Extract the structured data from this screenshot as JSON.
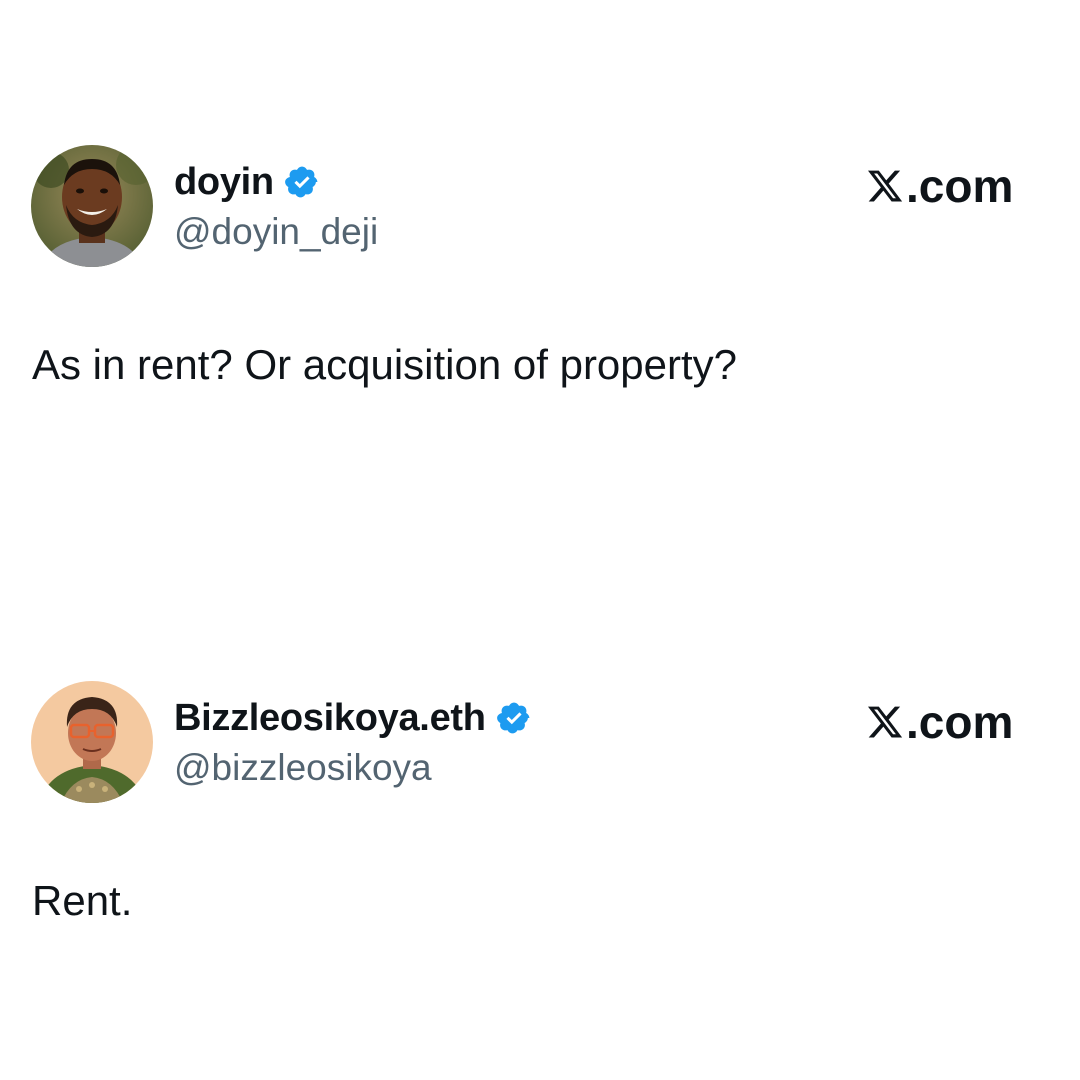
{
  "tweets": [
    {
      "display_name": "doyin",
      "handle": "@doyin_deji",
      "verified": true,
      "brand": ".com",
      "text": "As in rent? Or acquisition of property?"
    },
    {
      "display_name": "Bizzleosikoya.eth",
      "handle": "@bizzleosikoya",
      "verified": true,
      "brand": ".com",
      "text": "Rent."
    }
  ],
  "colors": {
    "text": "#0f1419",
    "secondary": "#536471",
    "verified": "#1d9bf0",
    "background": "#ffffff"
  },
  "icons": [
    "verified-badge-icon",
    "x-logo-icon"
  ]
}
